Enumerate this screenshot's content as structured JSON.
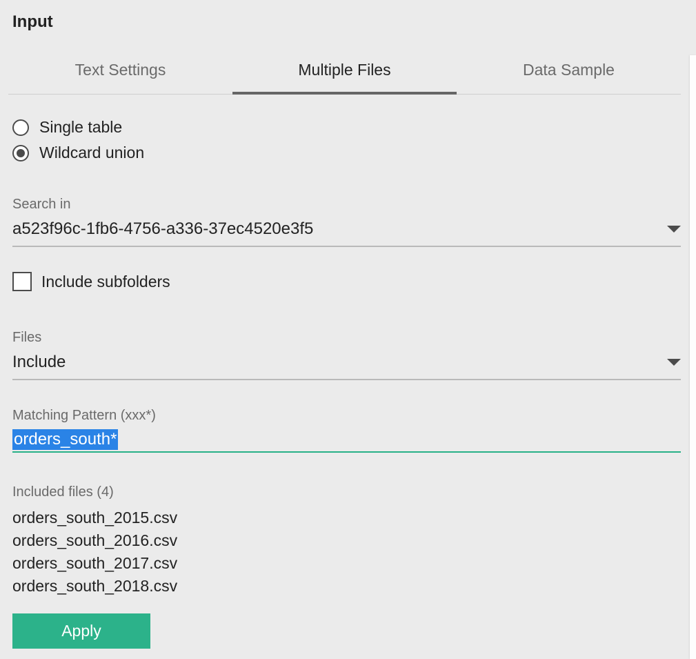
{
  "header": {
    "title": "Input"
  },
  "tabs": [
    {
      "label": "Text Settings",
      "active": false
    },
    {
      "label": "Multiple Files",
      "active": true
    },
    {
      "label": "Data Sample",
      "active": false
    }
  ],
  "tableMode": {
    "options": [
      {
        "label": "Single table",
        "selected": false
      },
      {
        "label": "Wildcard union",
        "selected": true
      }
    ]
  },
  "searchIn": {
    "label": "Search in",
    "value": "a523f96c-1fb6-4756-a336-37ec4520e3f5"
  },
  "includeSubfolders": {
    "label": "Include subfolders",
    "checked": false
  },
  "filesFilter": {
    "label": "Files",
    "value": "Include"
  },
  "matchingPattern": {
    "label": "Matching Pattern (xxx*)",
    "value": "orders_south*"
  },
  "includedFiles": {
    "label": "Included files (4)",
    "items": [
      "orders_south_2015.csv",
      "orders_south_2016.csv",
      "orders_south_2017.csv",
      "orders_south_2018.csv"
    ]
  },
  "apply": {
    "label": "Apply"
  }
}
